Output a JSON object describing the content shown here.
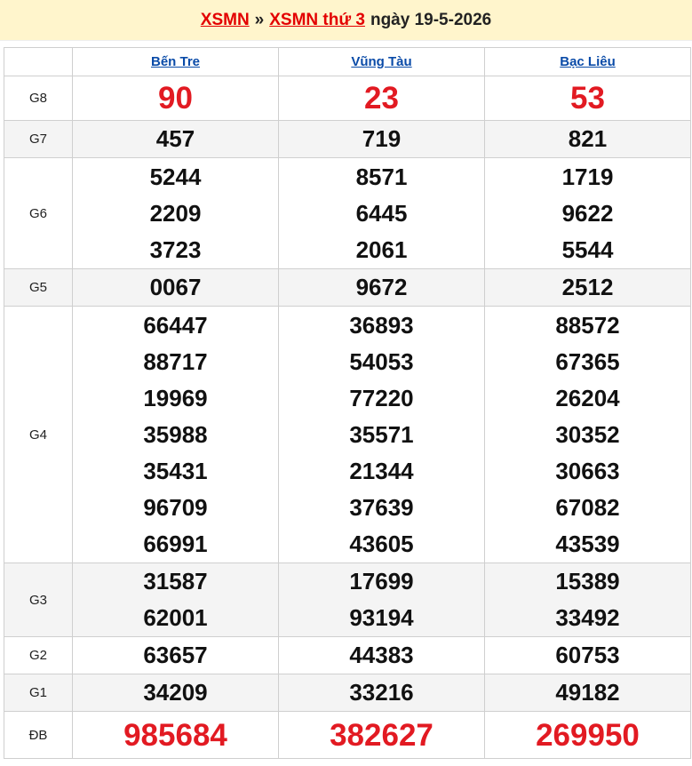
{
  "header": {
    "link1": "XSMN",
    "separator": "»",
    "link2": "XSMN thứ 3",
    "date_text": "ngày 19-5-2026"
  },
  "provinces": [
    "Bến Tre",
    "Vũng Tàu",
    "Bạc Liêu"
  ],
  "prizes": [
    {
      "label": "G8",
      "values": [
        [
          "90"
        ],
        [
          "23"
        ],
        [
          "53"
        ]
      ]
    },
    {
      "label": "G7",
      "values": [
        [
          "457"
        ],
        [
          "719"
        ],
        [
          "821"
        ]
      ]
    },
    {
      "label": "G6",
      "values": [
        [
          "5244",
          "2209",
          "3723"
        ],
        [
          "8571",
          "6445",
          "2061"
        ],
        [
          "1719",
          "9622",
          "5544"
        ]
      ]
    },
    {
      "label": "G5",
      "values": [
        [
          "0067"
        ],
        [
          "9672"
        ],
        [
          "2512"
        ]
      ]
    },
    {
      "label": "G4",
      "values": [
        [
          "66447",
          "88717",
          "19969",
          "35988",
          "35431",
          "96709",
          "66991"
        ],
        [
          "36893",
          "54053",
          "77220",
          "35571",
          "21344",
          "37639",
          "43605"
        ],
        [
          "88572",
          "67365",
          "26204",
          "30352",
          "30663",
          "67082",
          "43539"
        ]
      ]
    },
    {
      "label": "G3",
      "values": [
        [
          "31587",
          "62001"
        ],
        [
          "17699",
          "93194"
        ],
        [
          "15389",
          "33492"
        ]
      ]
    },
    {
      "label": "G2",
      "values": [
        [
          "63657"
        ],
        [
          "44383"
        ],
        [
          "60753"
        ]
      ]
    },
    {
      "label": "G1",
      "values": [
        [
          "34209"
        ],
        [
          "33216"
        ],
        [
          "49182"
        ]
      ]
    },
    {
      "label": "ĐB",
      "values": [
        [
          "985684"
        ],
        [
          "382627"
        ],
        [
          "269950"
        ]
      ]
    }
  ],
  "colors": {
    "accent_red": "#e21a22",
    "link_blue": "#0a4ba8",
    "header_bg": "#fff5cc"
  }
}
